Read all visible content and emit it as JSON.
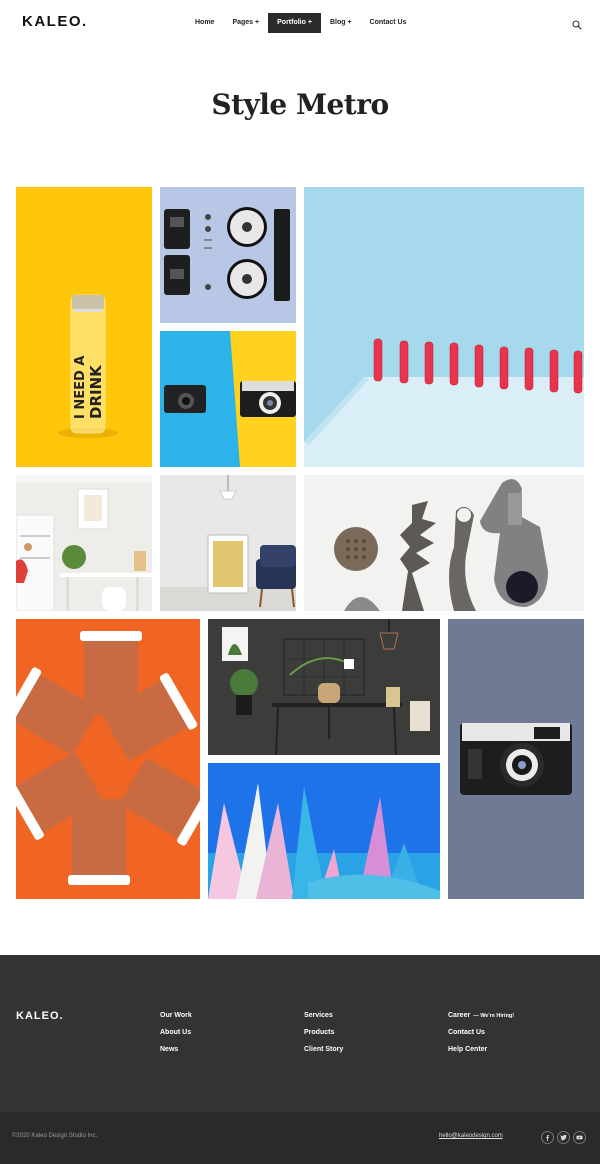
{
  "header": {
    "logo": "KALEO.",
    "nav": [
      {
        "label": "Home"
      },
      {
        "label": "Pages +"
      },
      {
        "label": "Portfolio +"
      },
      {
        "label": "Blog +"
      },
      {
        "label": "Contact Us"
      }
    ],
    "active_nav": "Portfolio +",
    "search_icon": "search-icon"
  },
  "main": {
    "title": "Style Metro",
    "bottle_text": {
      "line1": "I NEED A",
      "line2": "DRINK"
    }
  },
  "footer": {
    "logo": "KALEO.",
    "col1": [
      "Our Work",
      "About Us",
      "News"
    ],
    "col2": [
      "Services",
      "Products",
      "Client Story"
    ],
    "col3": {
      "career": "Career",
      "career_tag": "— We're Hiring!",
      "contact": "Contact Us",
      "help": "Help Center"
    },
    "copyright": "©2020 Kaleo Design Studio Inc.",
    "email": "hello@kaleodesign.com",
    "social": [
      "facebook-icon",
      "twitter-icon",
      "youtube-icon"
    ]
  },
  "colors": {
    "accent": "#2b2b2b",
    "footer_bg": "#333333",
    "bottom_bar_bg": "#2a2a2a"
  }
}
